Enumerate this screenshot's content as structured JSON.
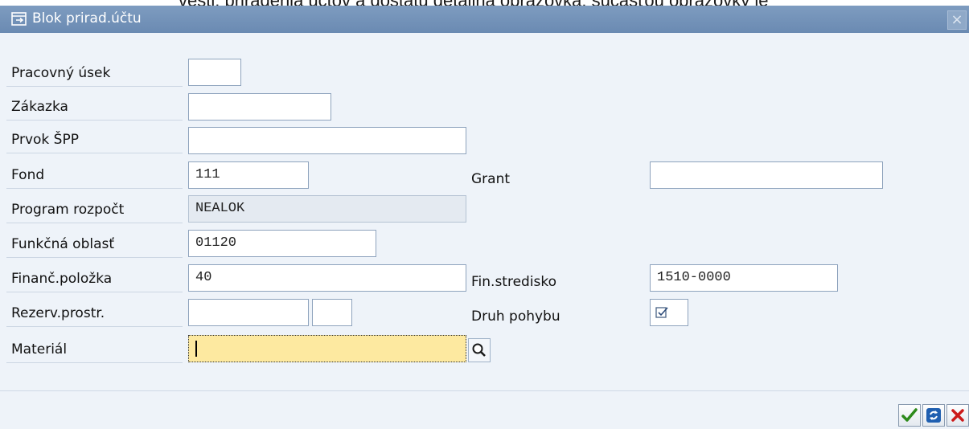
{
  "background_text": "vesti, priradenia účtov a dostatu detailná obrazovka: súčasťou obrazovky je",
  "dialog": {
    "title": "Blok prirad.účtu",
    "close_symbol": "×"
  },
  "form": {
    "rows": [
      {
        "label": "Pracovný úsek",
        "value": ""
      },
      {
        "label": "Zákazka",
        "value": ""
      },
      {
        "label": "Prvok ŠPP",
        "value": ""
      },
      {
        "label": "Fond",
        "value": "111"
      },
      {
        "label": "Program rozpočt",
        "value": "NEALOK"
      },
      {
        "label": "Funkčná oblasť",
        "value": "01120"
      },
      {
        "label": "Finanč.položka",
        "value": "40"
      },
      {
        "label": "Rezerv.prostr.",
        "value": "",
        "value2": ""
      },
      {
        "label": "Materiál",
        "value": ""
      }
    ],
    "right": {
      "grant_label": "Grant",
      "grant_value": "",
      "fin_center_label": "Fin.stredisko",
      "fin_center_value": "1510-0000",
      "movement_label": "Druh pohybu"
    }
  },
  "icons": {
    "title": "dialog-icon",
    "search": "search-help-icon",
    "confirm": "checkmark-icon",
    "refresh": "refresh-icon",
    "cancel": "cancel-icon"
  },
  "colors": {
    "titlebar": "#7593b9",
    "dialog_bg": "#eef3f9",
    "focused_field": "#fde9a0",
    "confirm": "#2d8a1a",
    "cancel": "#cc1a1a",
    "refresh": "#1f5fb0"
  }
}
